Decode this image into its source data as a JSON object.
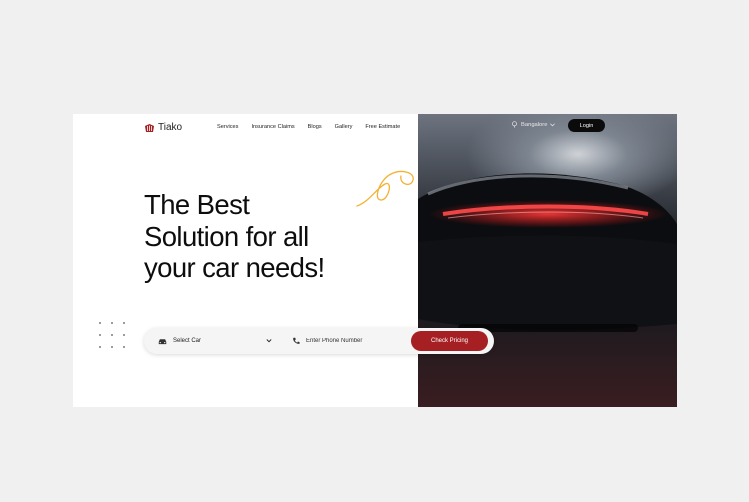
{
  "brand": {
    "name": "Tiako",
    "icon": "tiako-logo-icon",
    "accent": "#a51f23"
  },
  "nav": {
    "items": [
      {
        "label": "Services"
      },
      {
        "label": "Insurance Claims"
      },
      {
        "label": "Blogs"
      },
      {
        "label": "Gallery"
      },
      {
        "label": "Free Estimate"
      }
    ]
  },
  "header": {
    "location": "Bangalore",
    "login_label": "Login"
  },
  "hero": {
    "lines": [
      "The Best",
      "Solution for all",
      "your car needs!"
    ]
  },
  "search": {
    "car_select_value": "Select Car",
    "phone_placeholder": "Enter Phone Number",
    "cta_label": "Check Pricing"
  },
  "colors": {
    "page_bg": "#f0f0f0",
    "cta": "#a51f23",
    "login_bg": "#0b0b0b",
    "squiggle": "#f2b233"
  }
}
